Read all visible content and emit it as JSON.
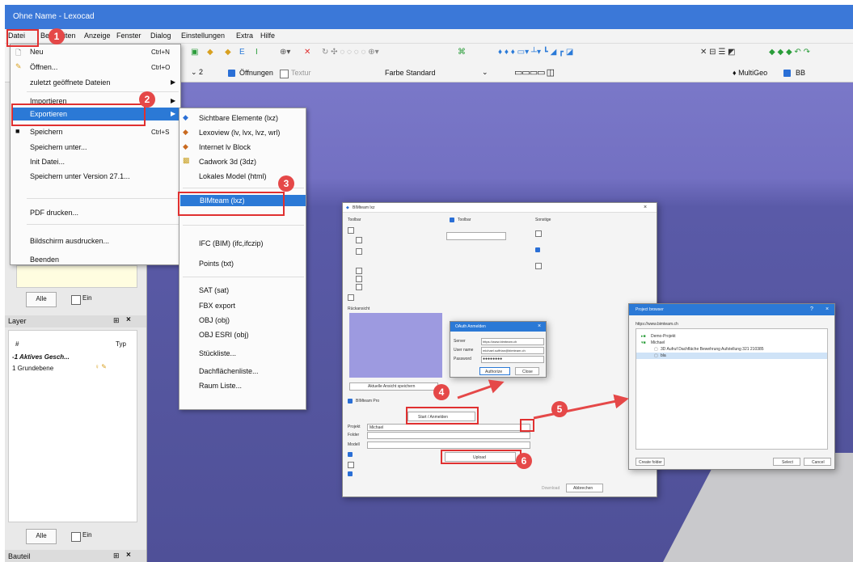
{
  "app": {
    "title": "Ohne Name - Lexocad"
  },
  "menubar": [
    "Datei",
    "Bearbeiten",
    "Anzeige",
    "Fenster",
    "Dialog",
    "Einstellungen",
    "Extra",
    "Hilfe"
  ],
  "toolbar2": {
    "zoom_value": "2",
    "openings_label": "Öffnungen",
    "texture_label": "Textur",
    "color_label": "Farbe Standard",
    "multigeo_label": "MultiGeo",
    "bb_label": "BB"
  },
  "file_menu": {
    "items": [
      {
        "label": "Neu",
        "shortcut": "Ctrl+N"
      },
      {
        "label": "Öffnen...",
        "shortcut": "Ctrl+O"
      },
      {
        "label": "zuletzt geöffnete Dateien"
      },
      {
        "label": "Importieren"
      },
      {
        "label": "Exportieren"
      },
      {
        "label": "Speichern",
        "shortcut": "Ctrl+S"
      },
      {
        "label": "Speichern unter..."
      },
      {
        "label": "Init Datei..."
      },
      {
        "label": "Speichern unter Version 27.1..."
      },
      {
        "label": "PDF drucken..."
      },
      {
        "label": "Bildschirm ausdrucken..."
      },
      {
        "label": "Beenden"
      }
    ]
  },
  "export_menu": {
    "items": [
      "Sichtbare Elemente (lxz)",
      "Lexoview (lv, lvx, lvz, wrl)",
      "Internet lv Block",
      "Cadwork 3d (3dz)",
      "Lokales Model (html)",
      "BIMteam (lxz)",
      "IFC (BIM) (ifc,ifczip)",
      "Points (txt)",
      "SAT (sat)",
      "FBX export",
      "OBJ (obj)",
      "OBJ ESRI (obj)",
      "Stückliste...",
      "Dachflächenliste...",
      "Raum Liste..."
    ]
  },
  "left_panel": {
    "all_button": "Alle",
    "ein_label": "Ein",
    "layer_title": "Layer",
    "col_hash": "#",
    "col_type": "Typ",
    "layer_rows": [
      "-1 Aktives Gesch...",
      "1  Grundebene"
    ],
    "all_button2": "Alle",
    "ein_label2": "Ein",
    "bauteil_title": "Bauteil"
  },
  "badges": [
    "1",
    "2",
    "3",
    "4",
    "5",
    "6"
  ],
  "bimteam_dialog": {
    "title": "BIMteam lxz",
    "toolbar_label": "Toolbar",
    "sonstige_label": "Sonstige",
    "rueckansicht_label": "Rückansicht",
    "save_view_button": "Aktuelle Ansicht speichern",
    "bimteam_pro_label": "BIMteam Pro",
    "auth_button": "Start / Anmelden",
    "project_label": "Projekt",
    "project_value": "Michael",
    "folder_label": "Folder",
    "model_label": "Modell",
    "upload_button": "Upload",
    "cancel_button": "Abbrechen",
    "download_button": "Download"
  },
  "auth_dialog": {
    "title": "OAuth Anmelden",
    "server_label": "Server",
    "server_value": "https://www.bimteam.ch",
    "user_label": "User name",
    "user_value": "michael.suffrian@bimteam.ch",
    "password_label": "Password",
    "password_value": "●●●●●●●●",
    "authorize_button": "Authorize",
    "close_button": "Close"
  },
  "project_dialog": {
    "title": "Project browser",
    "url": "https://www.bimteam.ch",
    "tree": [
      "Demo-Projekt",
      "Michael",
      "3D Aufruf Dachfläche Bewehrung Aufstellung 321 210385",
      "bla"
    ],
    "create_folder": "Create folder",
    "select_button": "Select",
    "cancel_button": "Cancel"
  },
  "colors": {
    "titlebar": "#3b78d8",
    "highlight": "#2b79d6",
    "badge": "#e54848",
    "viewport": "#5b5cac"
  }
}
